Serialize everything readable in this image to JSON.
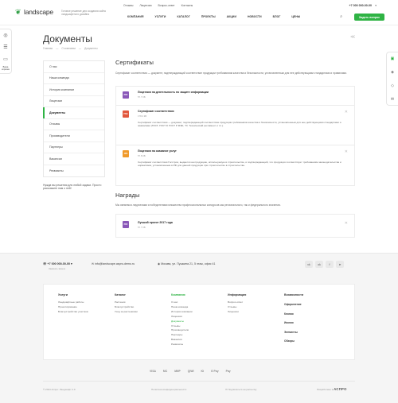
{
  "header": {
    "logo": "landscape",
    "tagline": "Готовое решение для создания сайта ландшафтного дизайна",
    "top_links": [
      "Отзывы",
      "Лицензии",
      "Вопрос-ответ",
      "Контакты"
    ],
    "phone": "+7 000 000-00-00",
    "nav": [
      "Компания",
      "Услуги",
      "Каталог",
      "Проекты",
      "Акции",
      "Новости",
      "Блог",
      "Цены"
    ],
    "order_button": "Задать вопрос"
  },
  "left_rail": {
    "cart_label": "Ваша корзина"
  },
  "page": {
    "title": "Документы",
    "breadcrumbs": [
      "Главная",
      "О компании",
      "Документы"
    ]
  },
  "sidebar": {
    "items": [
      "О нас",
      "Наша команда",
      "История компании",
      "Лицензии",
      "Документы",
      "Отзывы",
      "Производители",
      "Партнеры",
      "Вакансии",
      "Реквизиты"
    ],
    "active_index": 4,
    "note": "Нужда вы решения для любой задачи. Просто расскажите нам о ней!"
  },
  "certificates": {
    "title": "Сертификаты",
    "description": "Сертификат соответствия — документ, подтверждающий соответствие продукции требованиям качества и безопасности, установленным для нее действующими стандартами и правилами.",
    "docs": [
      {
        "type": "PDF",
        "name": "Лицензия на деятельность по защите информации",
        "size": "57.7 КБ",
        "text": ""
      },
      {
        "type": "PNG",
        "name": "Сертификат соответствия",
        "size": "178.2 КБ",
        "text": "Сертификат соответствия — документ, подтверждающий соответствие продукции требованиям качества и безопасности, установленным для нее действующими стандартами и правилами (ГОСТ, ГОСТ Р, ГОСТ Р МЭК, ТУ, Технический регламент и т.п.)."
      },
      {
        "type": "JPG",
        "name": "Лицензия на оказание услуг",
        "size": "57.8 КБ",
        "text": "Сертификат соответствия Госстроя, выдается на продукцию, используемую в строительстве, и подтверждающий, что продукция соответствует требованиям законодательства и нормативов, установленным в РФ для данной продукции при строительстве в строительстве."
      }
    ]
  },
  "awards": {
    "title": "Награды",
    "description": "Мы являемся лауреатами и победителями множества профессиональных конкурсов как регионального, так и федерального значения.",
    "docs": [
      {
        "type": "PDF",
        "name": "Лучший проект 2017 года",
        "size": "57.7 КБ"
      }
    ]
  },
  "footer": {
    "phone": "+7 000 000-00-00",
    "phone_sub": "Заказать звонок",
    "email": "info@landscape.aspro-demo.ru",
    "address": "Москва, ул. Пушкина 21, 5 этаж, офис 41",
    "socials": [
      "vk",
      "ok",
      "fb",
      "tg"
    ],
    "columns": [
      {
        "title": "Услуги",
        "links": [
          "Ландшафтные работы",
          "Проектирование",
          "Благоустройство участков"
        ]
      },
      {
        "title": "Каталог",
        "links": [
          "Растения",
          "Благоустройство",
          "Уход за растениями"
        ]
      },
      {
        "title": "Компания",
        "links": [
          "О нас",
          "Наша команда",
          "История компании",
          "Лицензии",
          "Документы",
          "Отзывы",
          "Производители",
          "Партнеры",
          "Вакансии",
          "Реквизиты"
        ],
        "active": "Документы"
      },
      {
        "title": "Информация",
        "links": [
          "Вопрос-ответ",
          "Отзывы",
          "Лицензии"
        ]
      },
      {
        "title": "Возможности",
        "links": [
          "Оформление",
          "Кнопки",
          "Иконки",
          "Элементы",
          "Обзоры"
        ]
      }
    ],
    "payments": [
      "VISA",
      "MC",
      "МИР",
      "QIWI",
      "Ю",
      "G Pay",
      "Pay"
    ],
    "copyright": "© 2024 Аспро: Ландшафт 2.0",
    "policy": "Политика конфиденциальности",
    "subscribe": "Подписаться на рассылку",
    "developer_prefix": "Разработано в",
    "developer": "АСПРО"
  },
  "colors": {
    "accent": "#2fb344",
    "pdf": "#8a58b8",
    "png": "#e2573d",
    "jpg": "#f09a2b"
  }
}
